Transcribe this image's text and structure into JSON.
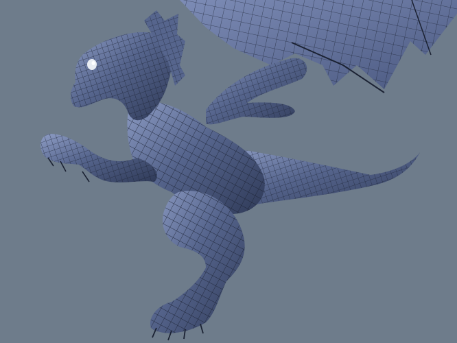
{
  "scene": {
    "subject": "dragon-wireframe-mesh",
    "colors": {
      "background": "#6e7c8b",
      "mesh_fill": "#4f5f86",
      "mesh_shadow": "#2f3a58",
      "mesh_highlight": "#8d9cc4",
      "wire": "#1b2233",
      "eye": "#e8ecf2"
    }
  }
}
